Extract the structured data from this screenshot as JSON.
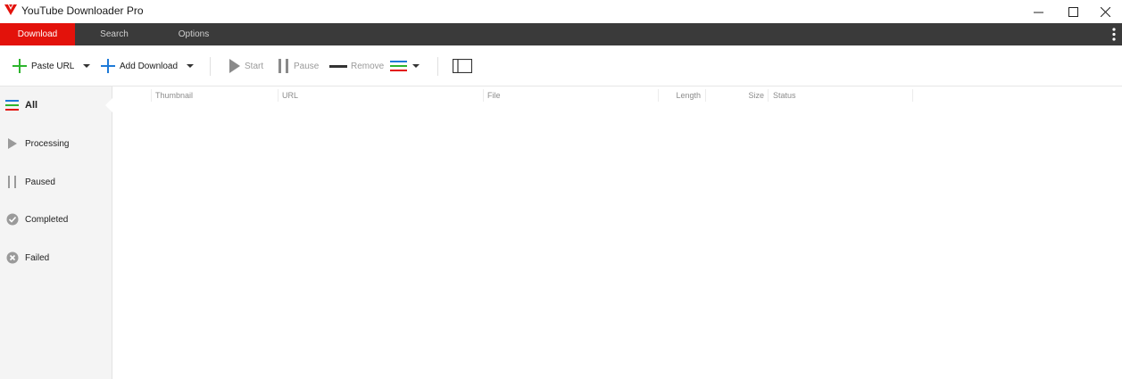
{
  "window": {
    "title": "YouTube Downloader Pro",
    "brand_color": "#e3120b",
    "controls": [
      "minimize-icon",
      "maximize-icon",
      "close-icon"
    ]
  },
  "menu": {
    "tabs": [
      {
        "label": "Download",
        "active": true
      },
      {
        "label": "Search",
        "active": false
      },
      {
        "label": "Options",
        "active": false
      }
    ],
    "more_icon": "vertical-dots-icon"
  },
  "toolbar": {
    "paste_url": "Paste URL",
    "add_download": "Add Download",
    "start": "Start",
    "pause": "Pause",
    "remove": "Remove",
    "icons": [
      "plus-icon",
      "chevron-down-icon",
      "play-icon",
      "pause-icon",
      "minus-icon",
      "list-menu-icon",
      "panel-toggle-icon"
    ]
  },
  "sidebar": {
    "items": [
      {
        "label": "All",
        "icon": "list-icon",
        "selected": true
      },
      {
        "label": "Processing",
        "icon": "play-icon"
      },
      {
        "label": "Paused",
        "icon": "pause-icon"
      },
      {
        "label": "Completed",
        "icon": "check-circle-icon"
      },
      {
        "label": "Failed",
        "icon": "x-circle-icon"
      }
    ]
  },
  "table": {
    "columns": [
      "Thumbnail",
      "URL",
      "File",
      "Length",
      "Size",
      "Status"
    ],
    "rows": []
  },
  "colors": {
    "green": "#2db52d",
    "blue": "#1e7ad8",
    "red": "#e3120b",
    "menubar": "#3a3a3a"
  }
}
